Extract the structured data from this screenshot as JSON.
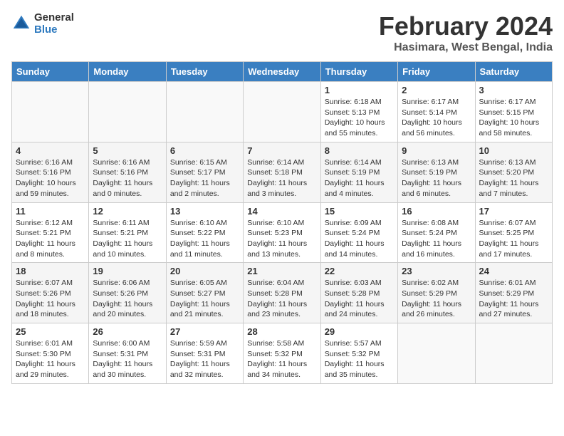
{
  "header": {
    "logo_general": "General",
    "logo_blue": "Blue",
    "title": "February 2024",
    "location": "Hasimara, West Bengal, India"
  },
  "weekdays": [
    "Sunday",
    "Monday",
    "Tuesday",
    "Wednesday",
    "Thursday",
    "Friday",
    "Saturday"
  ],
  "weeks": [
    [
      {
        "day": "",
        "info": ""
      },
      {
        "day": "",
        "info": ""
      },
      {
        "day": "",
        "info": ""
      },
      {
        "day": "",
        "info": ""
      },
      {
        "day": "1",
        "info": "Sunrise: 6:18 AM\nSunset: 5:13 PM\nDaylight: 10 hours and 55 minutes."
      },
      {
        "day": "2",
        "info": "Sunrise: 6:17 AM\nSunset: 5:14 PM\nDaylight: 10 hours and 56 minutes."
      },
      {
        "day": "3",
        "info": "Sunrise: 6:17 AM\nSunset: 5:15 PM\nDaylight: 10 hours and 58 minutes."
      }
    ],
    [
      {
        "day": "4",
        "info": "Sunrise: 6:16 AM\nSunset: 5:16 PM\nDaylight: 10 hours and 59 minutes."
      },
      {
        "day": "5",
        "info": "Sunrise: 6:16 AM\nSunset: 5:16 PM\nDaylight: 11 hours and 0 minutes."
      },
      {
        "day": "6",
        "info": "Sunrise: 6:15 AM\nSunset: 5:17 PM\nDaylight: 11 hours and 2 minutes."
      },
      {
        "day": "7",
        "info": "Sunrise: 6:14 AM\nSunset: 5:18 PM\nDaylight: 11 hours and 3 minutes."
      },
      {
        "day": "8",
        "info": "Sunrise: 6:14 AM\nSunset: 5:19 PM\nDaylight: 11 hours and 4 minutes."
      },
      {
        "day": "9",
        "info": "Sunrise: 6:13 AM\nSunset: 5:19 PM\nDaylight: 11 hours and 6 minutes."
      },
      {
        "day": "10",
        "info": "Sunrise: 6:13 AM\nSunset: 5:20 PM\nDaylight: 11 hours and 7 minutes."
      }
    ],
    [
      {
        "day": "11",
        "info": "Sunrise: 6:12 AM\nSunset: 5:21 PM\nDaylight: 11 hours and 8 minutes."
      },
      {
        "day": "12",
        "info": "Sunrise: 6:11 AM\nSunset: 5:21 PM\nDaylight: 11 hours and 10 minutes."
      },
      {
        "day": "13",
        "info": "Sunrise: 6:10 AM\nSunset: 5:22 PM\nDaylight: 11 hours and 11 minutes."
      },
      {
        "day": "14",
        "info": "Sunrise: 6:10 AM\nSunset: 5:23 PM\nDaylight: 11 hours and 13 minutes."
      },
      {
        "day": "15",
        "info": "Sunrise: 6:09 AM\nSunset: 5:24 PM\nDaylight: 11 hours and 14 minutes."
      },
      {
        "day": "16",
        "info": "Sunrise: 6:08 AM\nSunset: 5:24 PM\nDaylight: 11 hours and 16 minutes."
      },
      {
        "day": "17",
        "info": "Sunrise: 6:07 AM\nSunset: 5:25 PM\nDaylight: 11 hours and 17 minutes."
      }
    ],
    [
      {
        "day": "18",
        "info": "Sunrise: 6:07 AM\nSunset: 5:26 PM\nDaylight: 11 hours and 18 minutes."
      },
      {
        "day": "19",
        "info": "Sunrise: 6:06 AM\nSunset: 5:26 PM\nDaylight: 11 hours and 20 minutes."
      },
      {
        "day": "20",
        "info": "Sunrise: 6:05 AM\nSunset: 5:27 PM\nDaylight: 11 hours and 21 minutes."
      },
      {
        "day": "21",
        "info": "Sunrise: 6:04 AM\nSunset: 5:28 PM\nDaylight: 11 hours and 23 minutes."
      },
      {
        "day": "22",
        "info": "Sunrise: 6:03 AM\nSunset: 5:28 PM\nDaylight: 11 hours and 24 minutes."
      },
      {
        "day": "23",
        "info": "Sunrise: 6:02 AM\nSunset: 5:29 PM\nDaylight: 11 hours and 26 minutes."
      },
      {
        "day": "24",
        "info": "Sunrise: 6:01 AM\nSunset: 5:29 PM\nDaylight: 11 hours and 27 minutes."
      }
    ],
    [
      {
        "day": "25",
        "info": "Sunrise: 6:01 AM\nSunset: 5:30 PM\nDaylight: 11 hours and 29 minutes."
      },
      {
        "day": "26",
        "info": "Sunrise: 6:00 AM\nSunset: 5:31 PM\nDaylight: 11 hours and 30 minutes."
      },
      {
        "day": "27",
        "info": "Sunrise: 5:59 AM\nSunset: 5:31 PM\nDaylight: 11 hours and 32 minutes."
      },
      {
        "day": "28",
        "info": "Sunrise: 5:58 AM\nSunset: 5:32 PM\nDaylight: 11 hours and 34 minutes."
      },
      {
        "day": "29",
        "info": "Sunrise: 5:57 AM\nSunset: 5:32 PM\nDaylight: 11 hours and 35 minutes."
      },
      {
        "day": "",
        "info": ""
      },
      {
        "day": "",
        "info": ""
      }
    ]
  ]
}
